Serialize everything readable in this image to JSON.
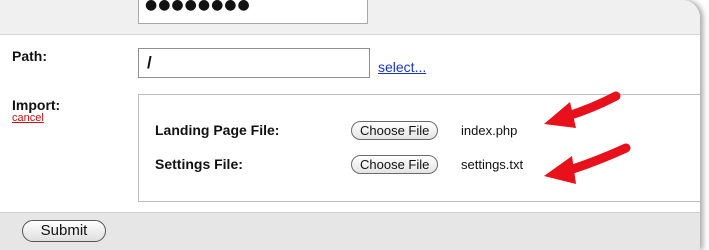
{
  "password": {
    "masked_value": "●●●●●●●●"
  },
  "path": {
    "label": "Path:",
    "value": "/",
    "select_link": "select..."
  },
  "import": {
    "label": "Import:",
    "cancel_link": "cancel",
    "landing": {
      "label": "Landing Page File:",
      "button": "Choose File",
      "file": "index.php"
    },
    "settings": {
      "label": "Settings File:",
      "button": "Choose File",
      "file": "settings.txt"
    }
  },
  "submit_label": "Submit",
  "annotations": {
    "arrow_color": "#e8101a",
    "arrow_icon": "red-arrow-icon"
  }
}
